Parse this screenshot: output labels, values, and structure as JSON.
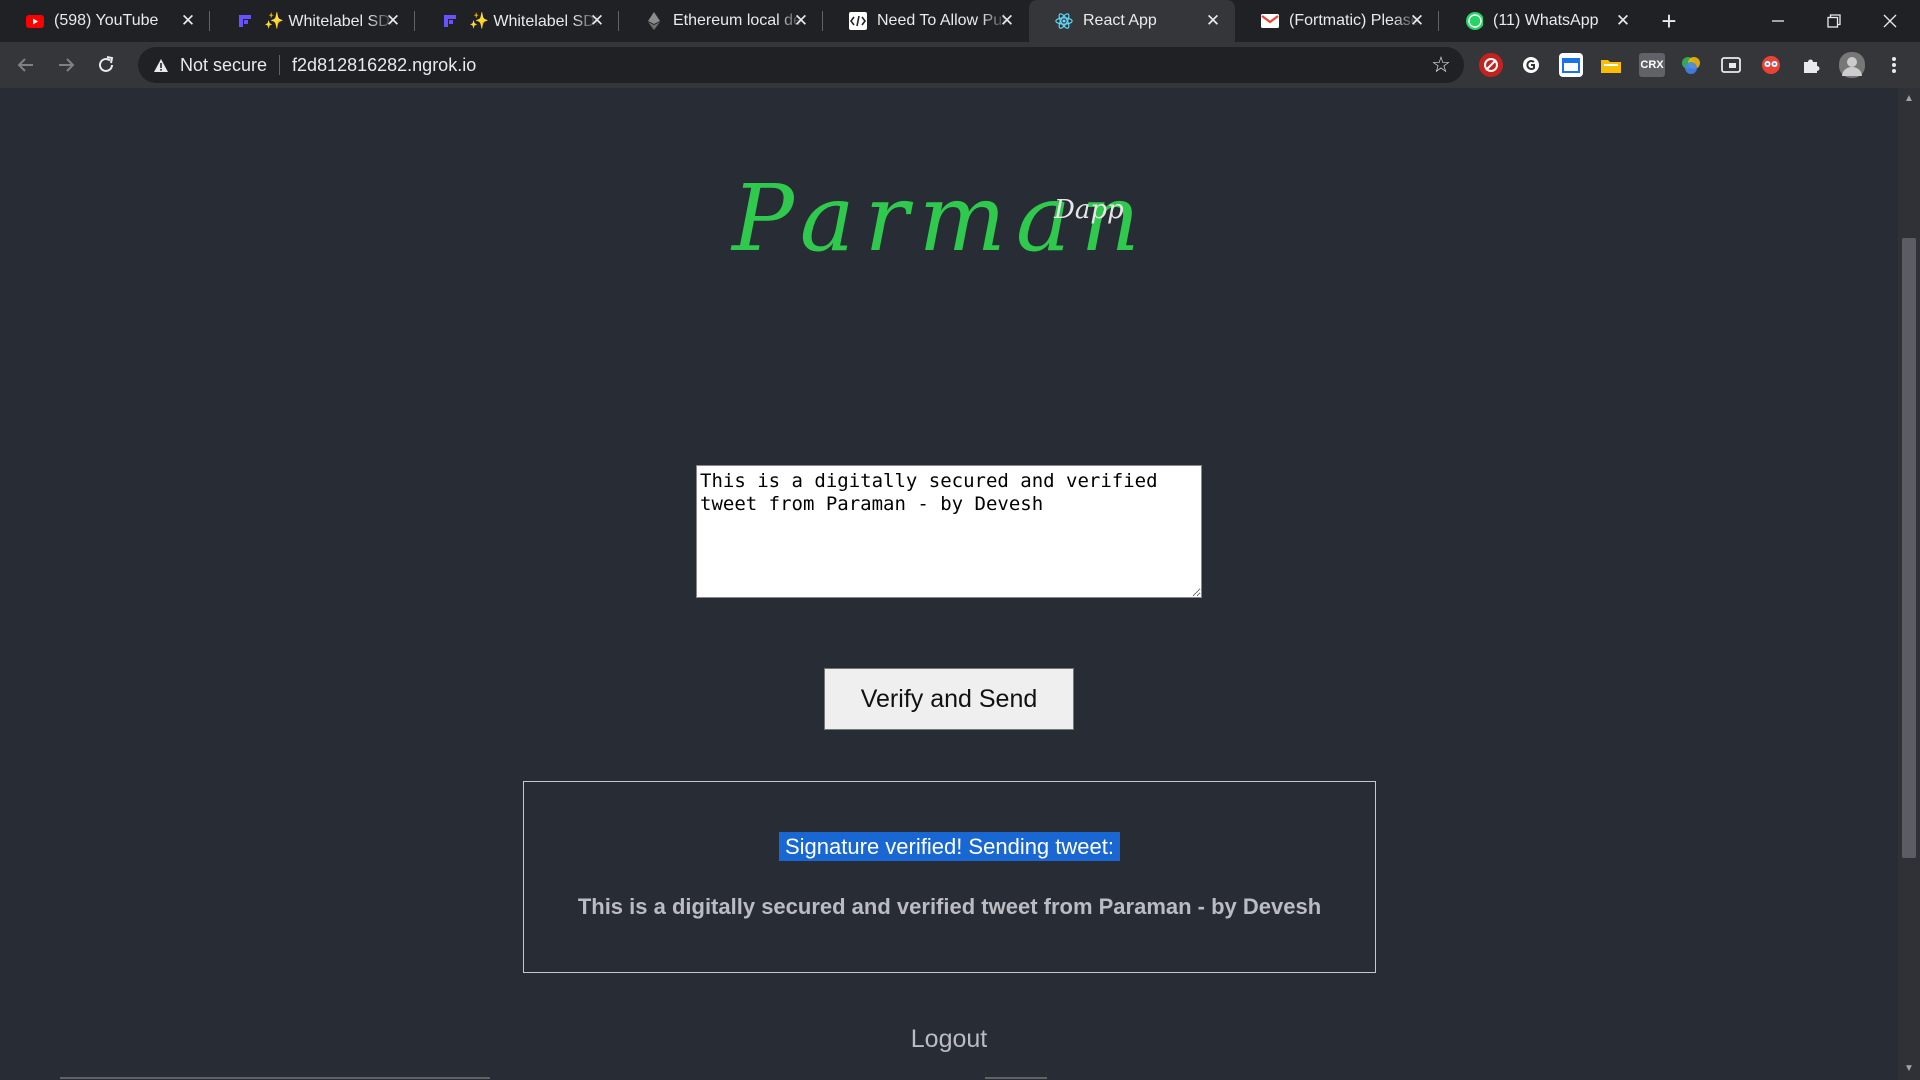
{
  "browser": {
    "tabs": [
      {
        "title": "(598) YouTube",
        "icon": "youtube-icon"
      },
      {
        "title": "✨ Whitelabel SDK",
        "icon": "fortmatic-icon"
      },
      {
        "title": "✨ Whitelabel SDK",
        "icon": "fortmatic-icon"
      },
      {
        "title": "Ethereum local dev",
        "icon": "ethereum-icon"
      },
      {
        "title": "Need To Allow Pub",
        "icon": "code-icon"
      },
      {
        "title": "React App",
        "icon": "react-icon"
      },
      {
        "title": "(Fortmatic) Please",
        "icon": "gmail-icon"
      },
      {
        "title": "(11) WhatsApp",
        "icon": "whatsapp-icon"
      }
    ],
    "active_tab_index": 5,
    "new_tab_label": "+",
    "address": {
      "security_label": "Not secure",
      "url": "f2d812816282.ngrok.io"
    },
    "extensions": [
      "ublock-icon",
      "grammarly-icon",
      "calendar-icon",
      "folder-icon",
      "crx-icon",
      "color-picker-icon",
      "cast-icon",
      "extension-icon",
      "puzzle-icon",
      "profile-avatar"
    ],
    "ext_crx_label": "CRX"
  },
  "app": {
    "logo": "Parman",
    "logo_sup": "Dapp",
    "tweet_text": "This is a digitally secured and verified tweet from Paraman - by Devesh",
    "verify_button": "Verify and Send",
    "status_message": "Signature verified! Sending tweet:",
    "sent_tweet": "This is a digitally secured and verified tweet from Paraman - by Devesh",
    "logout": "Logout"
  },
  "colors": {
    "logo_green": "#2ec94d",
    "page_bg": "#282c34",
    "selection_blue": "#1967d2"
  }
}
